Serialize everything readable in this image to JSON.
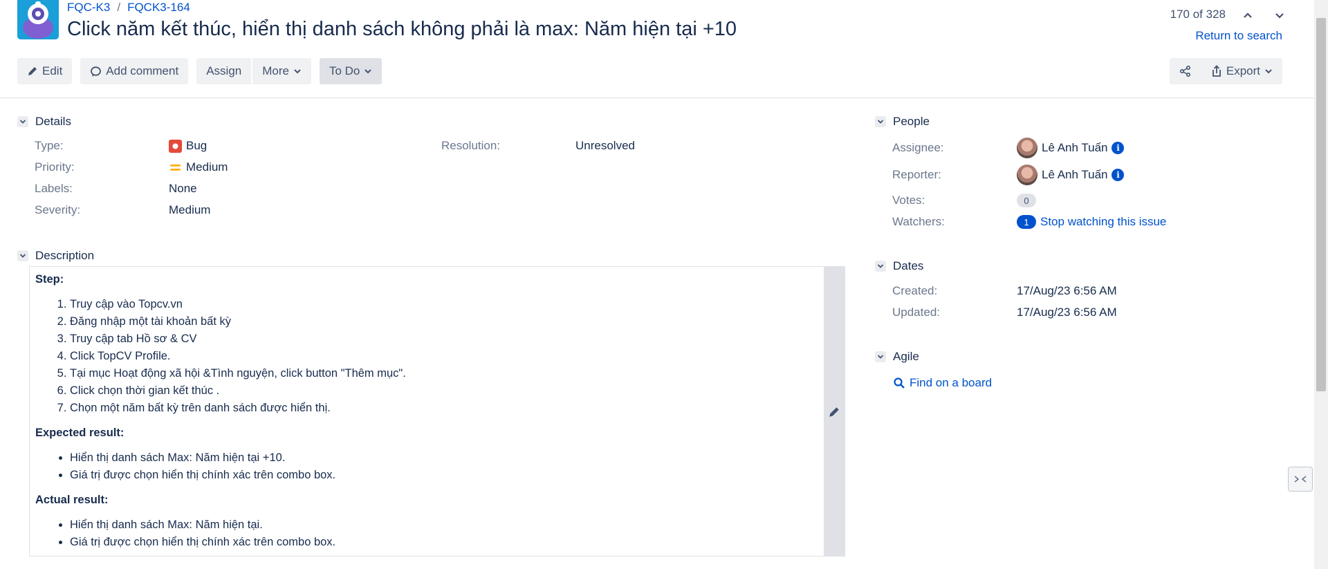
{
  "header": {
    "breadcrumbs": [
      "FQC-K3",
      "FQCK3-164"
    ],
    "title": "Click năm kết thúc, hiển thị danh sách không phải là max: Năm hiện tại +10",
    "pager": "170 of 328",
    "return_link": "Return to search"
  },
  "toolbar": {
    "edit": "Edit",
    "add_comment": "Add comment",
    "assign": "Assign",
    "more": "More",
    "status": "To Do",
    "export": "Export"
  },
  "details": {
    "heading": "Details",
    "type_label": "Type:",
    "type_value": "Bug",
    "priority_label": "Priority:",
    "priority_value": "Medium",
    "labels_label": "Labels:",
    "labels_value": "None",
    "severity_label": "Severity:",
    "severity_value": "Medium",
    "resolution_label": "Resolution:",
    "resolution_value": "Unresolved"
  },
  "description": {
    "heading": "Description",
    "step_heading": "Step:",
    "steps": [
      "Truy cập vào Topcv.vn",
      "Đăng nhập một tài khoản bất kỳ",
      "Truy cập tab Hồ sơ & CV",
      "Click TopCV Profile.",
      "Tại mục Hoạt động xã hội &Tình nguyện, click button \"Thêm mục\".",
      "Click chọn thời gian kết thúc .",
      "Chọn một năm bất kỳ trên danh sách được hiển thị."
    ],
    "expected_heading": "Expected result:",
    "expected": [
      "Hiển thị danh sách Max: Năm hiện tại +10.",
      "Giá trị được chọn hiển thị chính xác trên combo box."
    ],
    "actual_heading": "Actual result:",
    "actual": [
      "Hiển thị danh sách Max: Năm hiện tại.",
      "Giá trị được chọn hiển thị chính xác trên combo box."
    ]
  },
  "people": {
    "heading": "People",
    "assignee_label": "Assignee:",
    "assignee": "Lê Anh Tuấn",
    "reporter_label": "Reporter:",
    "reporter": "Lê Anh Tuấn",
    "votes_label": "Votes:",
    "votes": "0",
    "watchers_label": "Watchers:",
    "watchers": "1",
    "stop_watching": "Stop watching this issue"
  },
  "dates": {
    "heading": "Dates",
    "created_label": "Created:",
    "created": "17/Aug/23 6:56 AM",
    "updated_label": "Updated:",
    "updated": "17/Aug/23 6:56 AM"
  },
  "agile": {
    "heading": "Agile",
    "find_on_board": "Find on a board"
  },
  "colors": {
    "link": "#0052cc",
    "bug": "#e5493a",
    "priority": "#ffab00"
  }
}
